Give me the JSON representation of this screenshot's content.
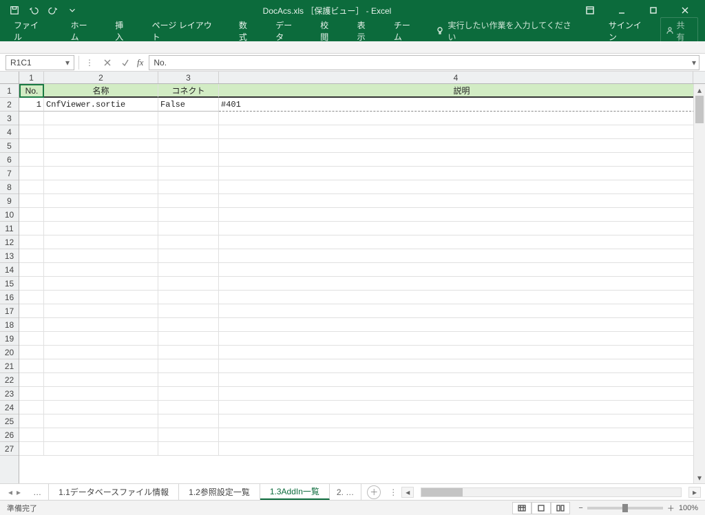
{
  "window": {
    "title": "DocAcs.xls ［保護ビュー］ - Excel"
  },
  "qat": {
    "save": "save",
    "undo": "undo",
    "redo": "redo"
  },
  "ribbon": {
    "tabs": [
      "ファイル",
      "ホーム",
      "挿入",
      "ページ レイアウト",
      "数式",
      "データ",
      "校閲",
      "表示",
      "チーム"
    ],
    "tell_me": "実行したい作業を入力してください",
    "signin": "サインイン",
    "share": "共有"
  },
  "formula": {
    "name_box": "R1C1",
    "value": "No."
  },
  "columns": {
    "col_numbers": [
      "1",
      "2",
      "3",
      "4"
    ]
  },
  "row_numbers": [
    "1",
    "2",
    "3",
    "4",
    "5",
    "6",
    "7",
    "8",
    "9",
    "10",
    "11",
    "12",
    "13",
    "14",
    "15",
    "16",
    "17",
    "18",
    "19",
    "20",
    "21",
    "22",
    "23",
    "24",
    "25",
    "26",
    "27"
  ],
  "sheet": {
    "headers": {
      "c1": "No.",
      "c2": "名称",
      "c3": "コネクト",
      "c4": "説明"
    },
    "rows": [
      {
        "no": "1",
        "name": "CnfViewer.sortie",
        "connect": "False",
        "desc": "#401"
      }
    ]
  },
  "tabs": {
    "ellipsis_left": "…",
    "items": [
      "1.1データベースファイル情報",
      "1.2参照設定一覧",
      "1.3AddIn一覧"
    ],
    "active_index": 2,
    "ellipsis_right_prefix": "2.",
    "ellipsis_right": "…"
  },
  "status": {
    "ready": "準備完了",
    "zoom": "100%"
  }
}
